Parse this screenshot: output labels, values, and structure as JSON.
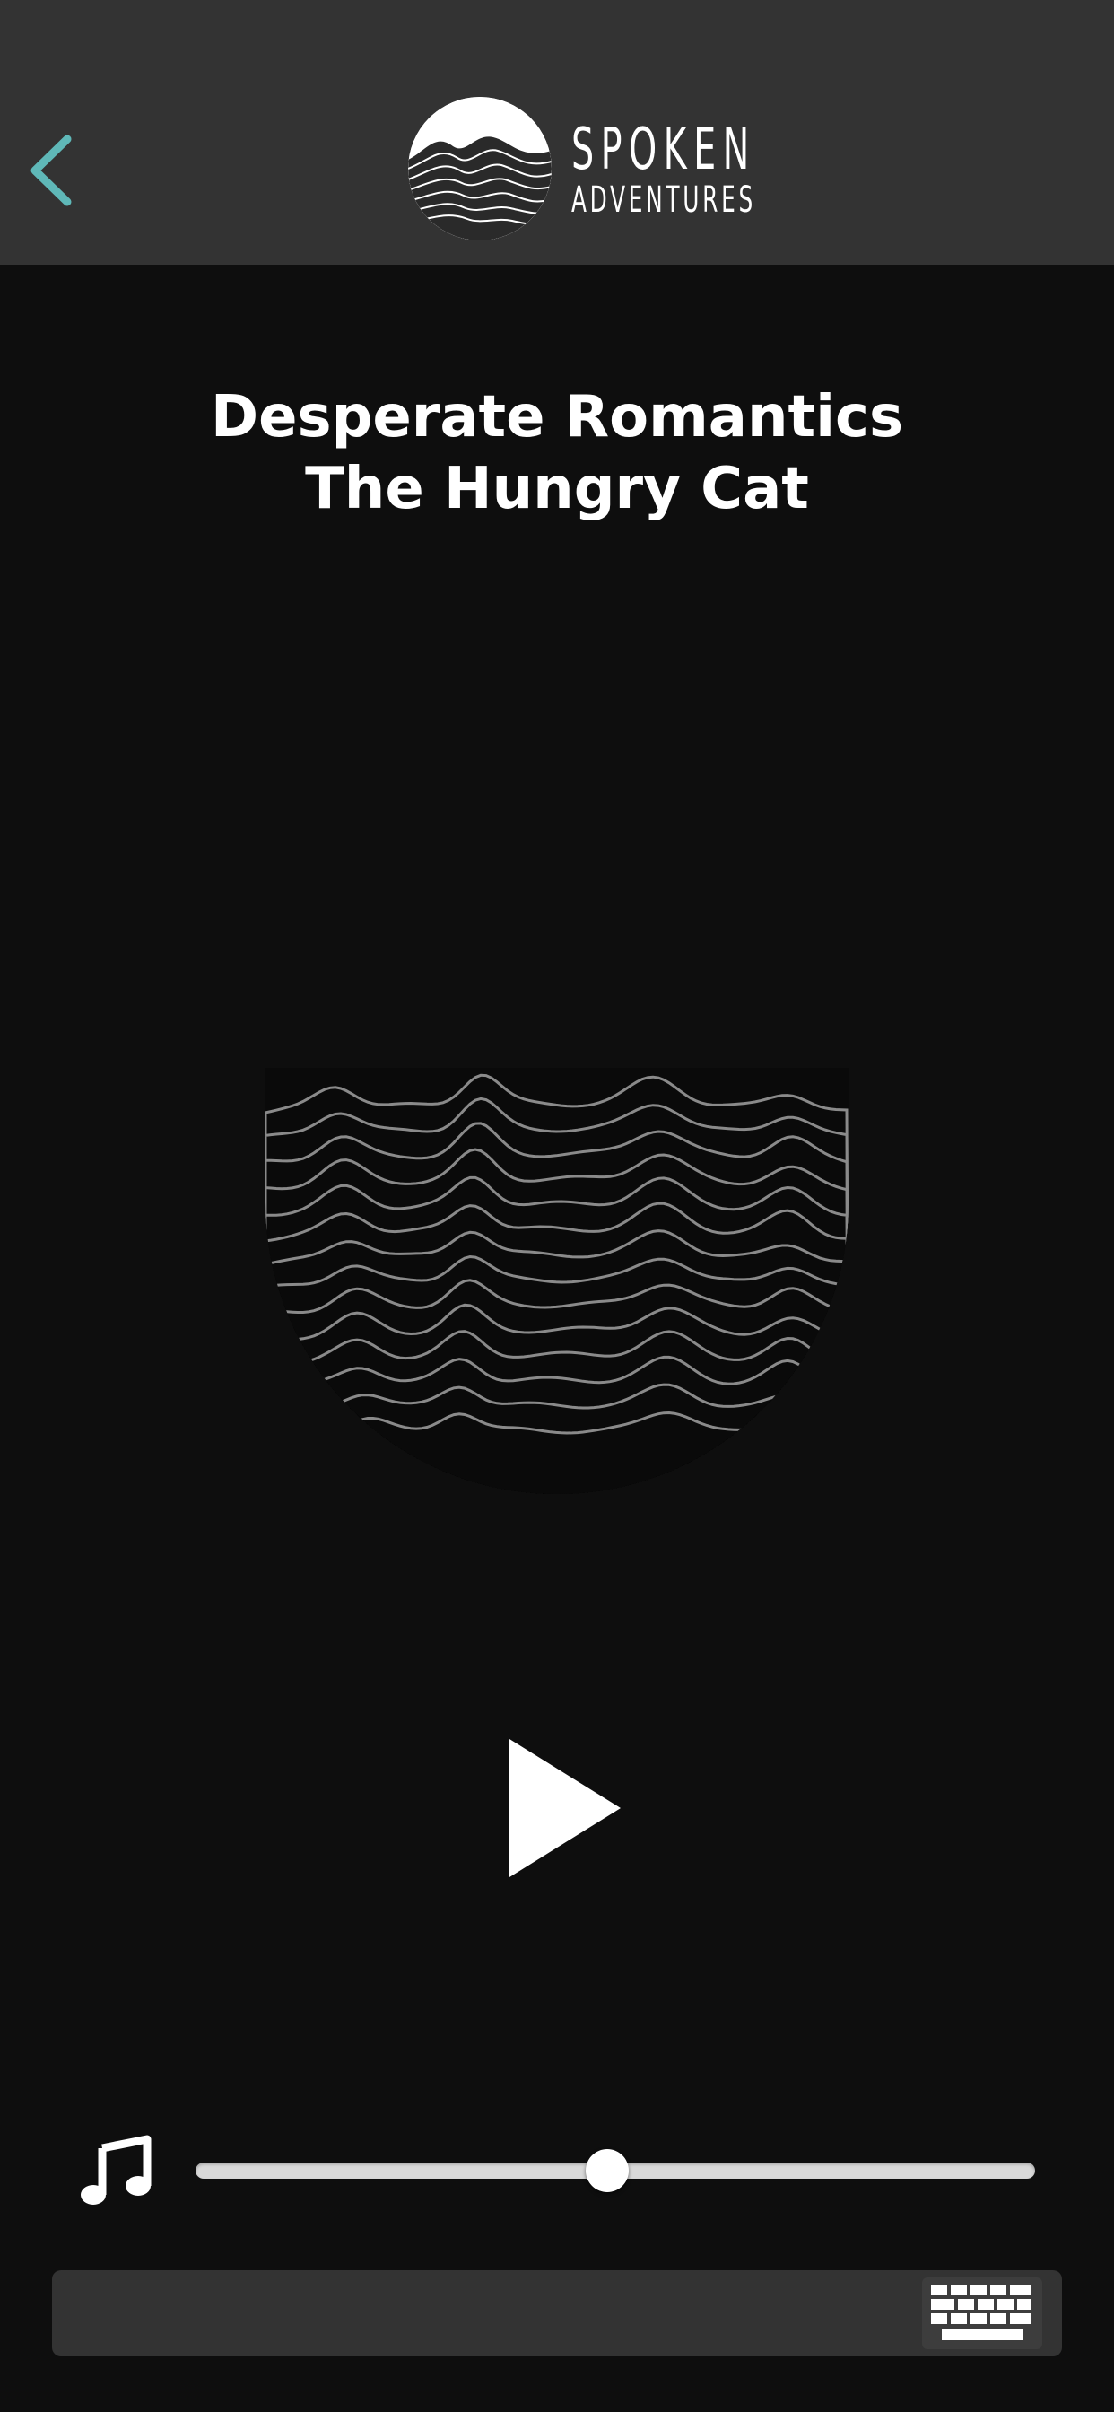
{
  "header": {
    "back_icon": "chevron-left-icon",
    "brand": {
      "line1": "SPOKEN",
      "line2": "ADVENTURES",
      "logo": "wave-mountain-logo"
    },
    "accent_color": "#5fb8b8",
    "background_color": "#333333"
  },
  "content": {
    "title": "Desperate Romantics",
    "subtitle": "The Hungry Cat",
    "artwork": "wave-lines-visual",
    "background_color": "#0e0e0e"
  },
  "player": {
    "play_icon": "play-icon",
    "music_icon": "music-note-icon",
    "volume_fraction": 0.49
  },
  "input_bar": {
    "value": "",
    "placeholder": "",
    "keyboard_icon": "keyboard-icon"
  }
}
